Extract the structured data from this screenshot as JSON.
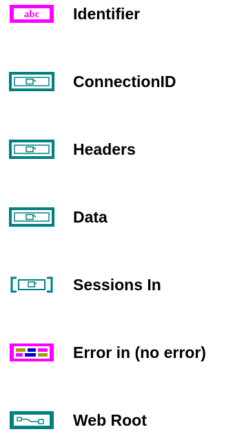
{
  "terminals": [
    {
      "label": "Identifier",
      "type": "string",
      "icon": "string-icon",
      "color": "#ff00ff"
    },
    {
      "label": "ConnectionID",
      "type": "refnum",
      "icon": "refnum-icon",
      "color": "#008080"
    },
    {
      "label": "Headers",
      "type": "refnum",
      "icon": "refnum-icon",
      "color": "#008080"
    },
    {
      "label": "Data",
      "type": "refnum",
      "icon": "refnum-icon",
      "color": "#008080"
    },
    {
      "label": "Sessions In",
      "type": "refnum-array",
      "icon": "refnum-array-icon",
      "color": "#008080"
    },
    {
      "label": "Error in (no error)",
      "type": "error-cluster",
      "icon": "error-cluster-icon",
      "color": "#ff00ff"
    },
    {
      "label": "Web Root",
      "type": "path",
      "icon": "path-icon",
      "color": "#008080"
    }
  ],
  "string_icon_text": "abc"
}
